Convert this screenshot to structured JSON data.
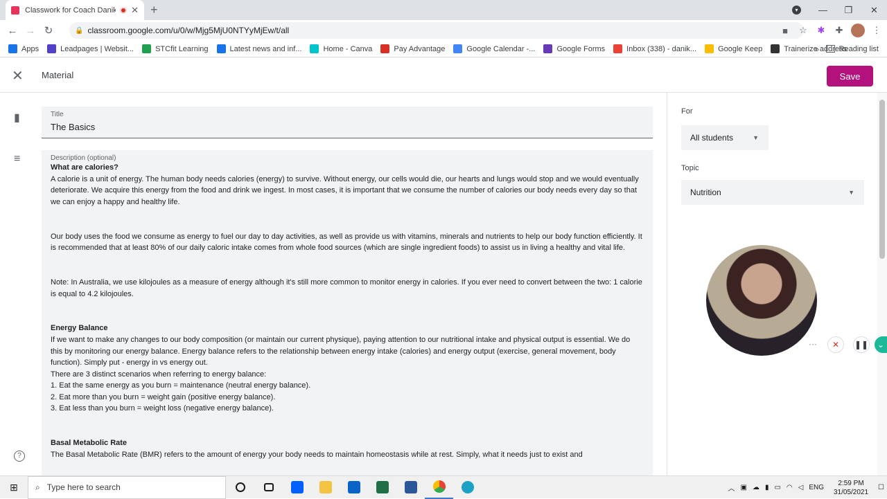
{
  "browser": {
    "tab_title": "Classwork for Coach Danika",
    "url": "classroom.google.com/u/0/w/Mjg5MjU0NTYyMjEw/t/all",
    "bookmarks": [
      {
        "label": "Apps",
        "color": "#1a73e8"
      },
      {
        "label": "Leadpages | Websit...",
        "color": "#5340c8"
      },
      {
        "label": "STCfit Learning",
        "color": "#20a050"
      },
      {
        "label": "Latest news and inf...",
        "color": "#1a73e8"
      },
      {
        "label": "Home - Canva",
        "color": "#00c4cc"
      },
      {
        "label": "Pay Advantage",
        "color": "#d93025"
      },
      {
        "label": "Google Calendar -...",
        "color": "#4285f4"
      },
      {
        "label": "Google Forms",
        "color": "#673ab7"
      },
      {
        "label": "Inbox (338) - danik...",
        "color": "#ea4335"
      },
      {
        "label": "Google Keep",
        "color": "#fbbc04"
      },
      {
        "label": "Trainerize address",
        "color": "#333333"
      }
    ],
    "bookmarks_more": "»",
    "reading_list": "Reading list"
  },
  "header": {
    "title": "Material",
    "save_label": "Save"
  },
  "form": {
    "title_label": "Title",
    "title_value": "The Basics",
    "description_label": "Description (optional)",
    "description": {
      "h1": "What are calories?",
      "p1": "A calorie is a unit of energy. The human body needs calories (energy) to survive. Without energy, our cells would die, our hearts and lungs would stop and we would eventually deteriorate. We acquire this energy from the food and drink we ingest. In most cases, it is important that we consume the number of calories our body needs every day so that we can enjoy a happy and healthy life.",
      "p2": "Our body uses the food we consume as energy to fuel our day to day activities, as well as provide us with vitamins, minerals and nutrients to help our body function efficiently. It is recommended that at least 80% of our daily caloric intake comes from whole food sources (which are single ingredient foods) to assist us in living a healthy and vital life.",
      "p3": "Note: In Australia, we use kilojoules as a measure of energy although it's still more common to monitor energy in calories. If you ever need to convert between the two: 1 calorie is equal to 4.2 kilojoules.",
      "h2": "Energy Balance",
      "p4": "If we want to make any changes to our body composition (or maintain our current physique), paying attention to our nutritional intake and physical output is essential. We do this by monitoring our energy balance. Energy balance refers to the relationship between energy intake (calories) and energy output (exercise, general movement, body function). Simply put - energy in vs energy out.",
      "p5": "There are 3 distinct scenarios when referring to energy balance:",
      "l1": "1. Eat the same energy as you burn = maintenance (neutral energy balance).",
      "l2": "2. Eat more than you burn = weight gain (positive energy balance).",
      "l3": "3. Eat less than you burn = weight loss (negative energy balance).",
      "h3": "Basal Metabolic Rate",
      "p6": "The Basal Metabolic Rate (BMR) refers to the amount of energy your body needs to maintain homeostasis while at rest. Simply, what it needs just to exist and"
    }
  },
  "side": {
    "for_label": "For",
    "for_value": "All students",
    "topic_label": "Topic",
    "topic_value": "Nutrition"
  },
  "taskbar": {
    "search_placeholder": "Type here to search",
    "lang": "ENG",
    "time": "2:59 PM",
    "date": "31/05/2021"
  }
}
